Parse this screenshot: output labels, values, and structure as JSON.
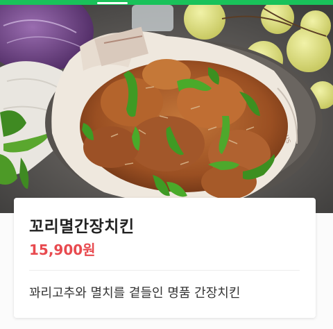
{
  "product": {
    "name": "꼬리멸간장치킨",
    "price": "15,900원",
    "description": "꽈리고추와 멸치를 곁들인 명품 간장치킨"
  },
  "hero_image": {
    "alt": "꼬리멸간장치킨"
  },
  "colors": {
    "brand_green": "#19c25a",
    "price_red": "#e84a4f"
  }
}
